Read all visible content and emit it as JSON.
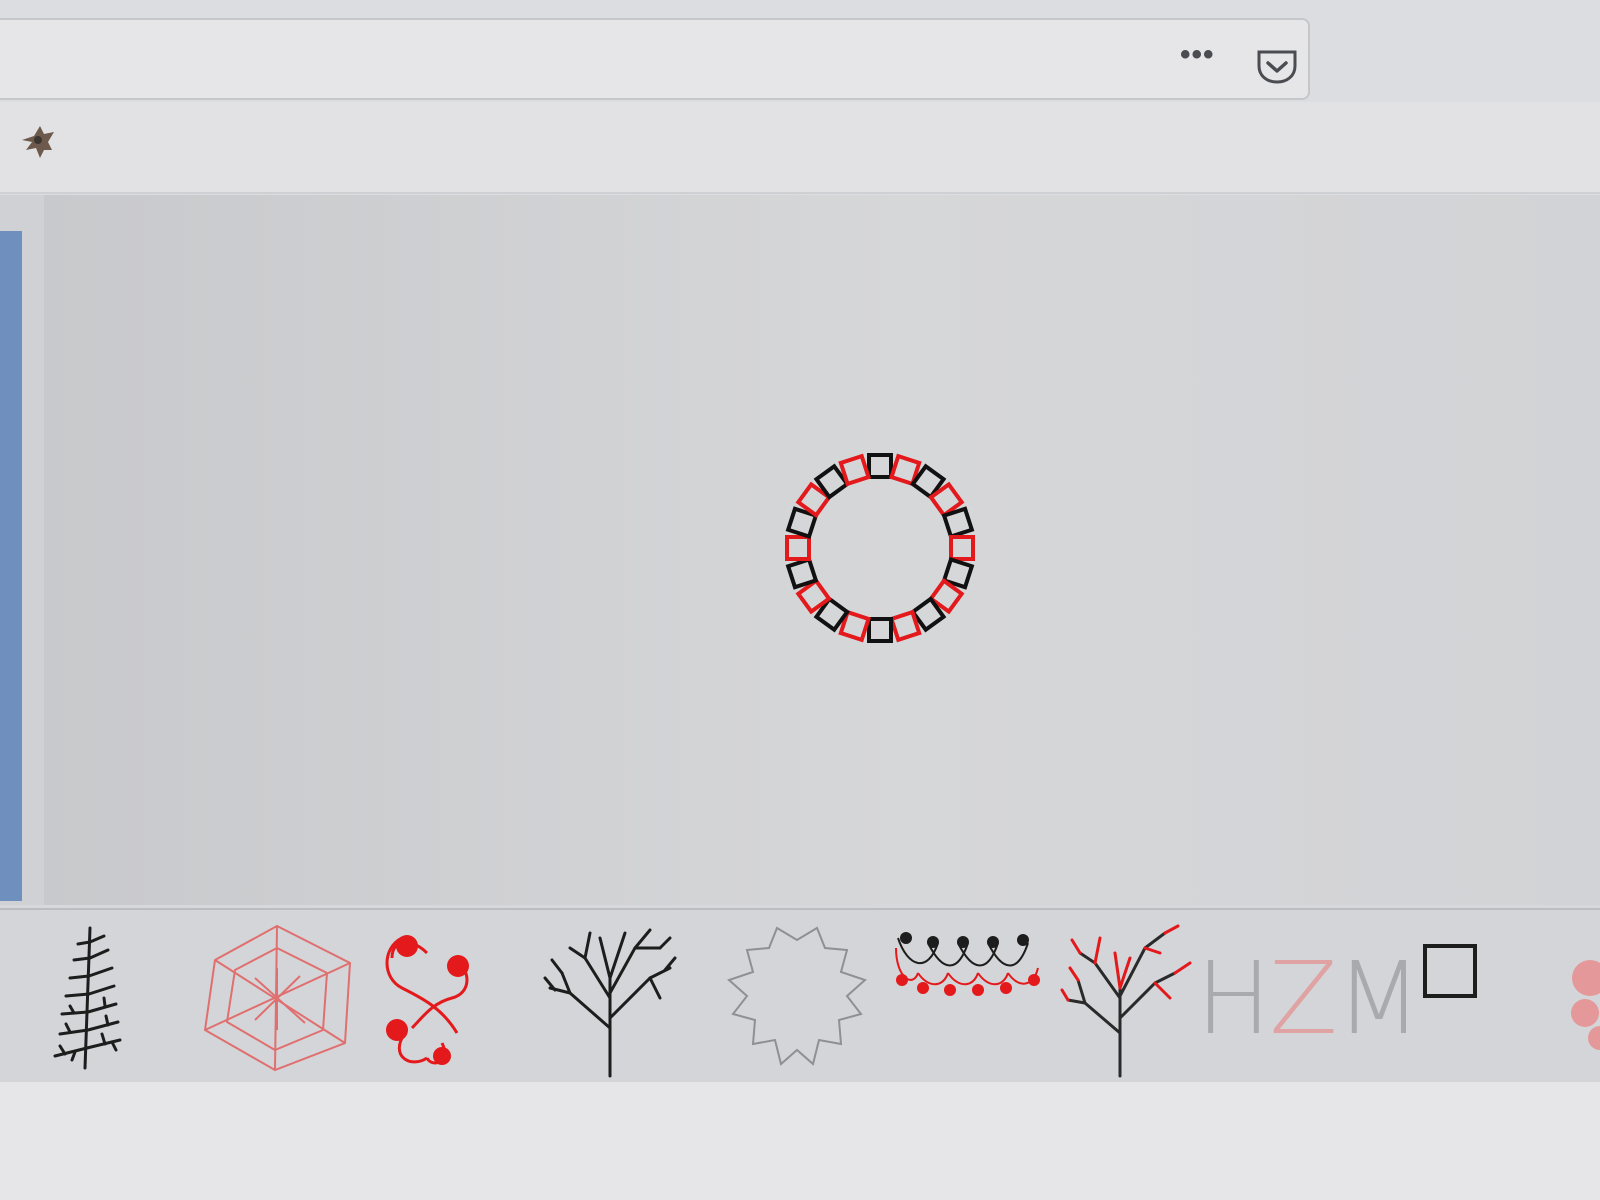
{
  "browser": {
    "more_icon": "ellipsis-icon",
    "more_label": "•••",
    "pocket_icon": "pocket-icon",
    "site_icon": "bird-favicon-icon"
  },
  "canvas": {
    "drawing": "ring-of-squares",
    "colors": {
      "red": "#e3191c",
      "black": "#111111"
    }
  },
  "gallery": {
    "items": [
      {
        "icon": "fern-fractal-icon"
      },
      {
        "icon": "pentagon-star-icon"
      },
      {
        "icon": "spiral-curls-icon"
      },
      {
        "icon": "black-tree-icon"
      },
      {
        "icon": "koch-snowflake-icon"
      },
      {
        "icon": "beaded-chain-icon"
      },
      {
        "icon": "red-tree-icon"
      },
      {
        "icon": "hzm-letters-icon",
        "text_h": "H",
        "text_z": "Z",
        "text_m": "M"
      },
      {
        "icon": "square-icon"
      },
      {
        "icon": "partial-red-icon"
      }
    ]
  }
}
